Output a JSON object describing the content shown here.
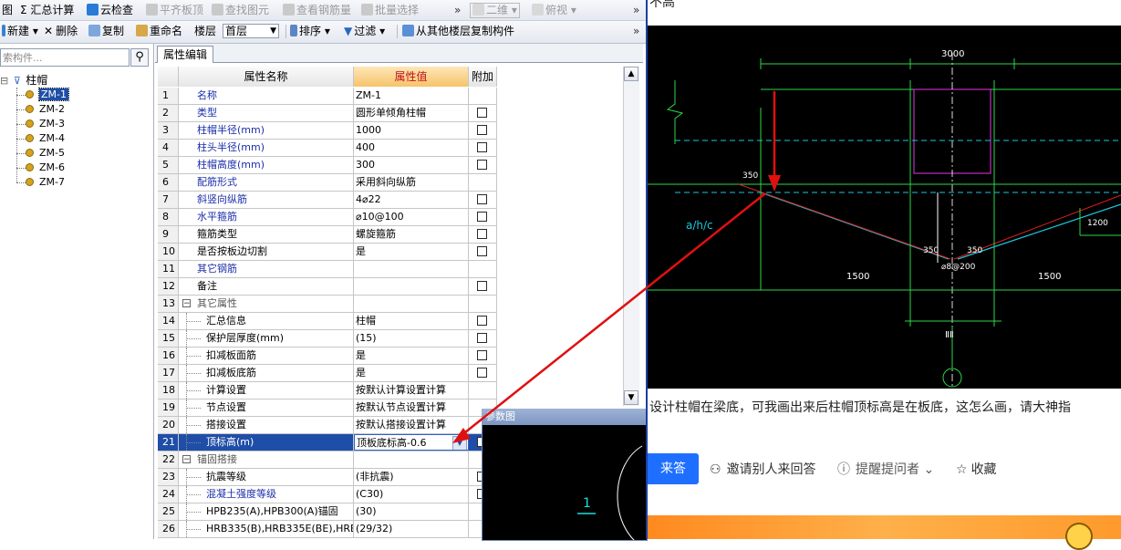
{
  "toolbar1": {
    "items": [
      "图",
      "Σ 汇总计算",
      "云检查",
      "平齐板顶",
      "查找图元",
      "查看钢筋量",
      "批量选择",
      "二维",
      "俯视"
    ],
    "overflow": "»"
  },
  "toolbar2": {
    "new_label": "新建",
    "delete_label": "删除",
    "copy_label": "复制",
    "rename_label": "重命名",
    "floor_label": "楼层",
    "floor_value": "首层",
    "sort_label": "排序",
    "filter_label": "过滤",
    "copy_from_floor_label": "从其他楼层复制构件",
    "overflow": "»"
  },
  "search": {
    "placeholder": "索构件..."
  },
  "tree": {
    "root": "柱帽",
    "items": [
      "ZM-1",
      "ZM-2",
      "ZM-3",
      "ZM-4",
      "ZM-5",
      "ZM-6",
      "ZM-7"
    ],
    "selected": "ZM-1"
  },
  "prop_tab": "属性编辑",
  "grid": {
    "headers": {
      "name": "属性名称",
      "value": "属性值",
      "extra": "附加"
    },
    "rows": [
      {
        "n": "1",
        "name": "名称",
        "value": "ZM-1",
        "style": "blue",
        "cb": false
      },
      {
        "n": "2",
        "name": "类型",
        "value": "圆形单倾角柱帽",
        "style": "blue",
        "cb": true
      },
      {
        "n": "3",
        "name": "柱帽半径(mm)",
        "value": "1000",
        "style": "blue",
        "cb": true
      },
      {
        "n": "4",
        "name": "柱头半径(mm)",
        "value": "400",
        "style": "blue",
        "cb": true
      },
      {
        "n": "5",
        "name": "柱帽高度(mm)",
        "value": "300",
        "style": "blue",
        "cb": true
      },
      {
        "n": "6",
        "name": "配筋形式",
        "value": "采用斜向纵筋",
        "style": "blue",
        "cb": false
      },
      {
        "n": "7",
        "name": "斜竖向纵筋",
        "value": "4⌀22",
        "style": "blue",
        "cb": true
      },
      {
        "n": "8",
        "name": "水平箍筋",
        "value": "⌀10@100",
        "style": "blue",
        "cb": true
      },
      {
        "n": "9",
        "name": "箍筋类型",
        "value": "螺旋箍筋",
        "style": "",
        "cb": true
      },
      {
        "n": "10",
        "name": "是否按板边切割",
        "value": "是",
        "style": "",
        "cb": true
      },
      {
        "n": "11",
        "name": "其它钢筋",
        "value": "",
        "style": "blue",
        "cb": false
      },
      {
        "n": "12",
        "name": "备注",
        "value": "",
        "style": "",
        "cb": true
      },
      {
        "n": "13",
        "name": "其它属性",
        "value": "",
        "style": "group",
        "cb": false
      },
      {
        "n": "14",
        "name": "汇总信息",
        "value": "柱帽",
        "style": "sub",
        "cb": true
      },
      {
        "n": "15",
        "name": "保护层厚度(mm)",
        "value": "(15)",
        "style": "sub",
        "cb": true
      },
      {
        "n": "16",
        "name": "扣减板面筋",
        "value": "是",
        "style": "sub",
        "cb": true
      },
      {
        "n": "17",
        "name": "扣减板底筋",
        "value": "是",
        "style": "sub",
        "cb": true
      },
      {
        "n": "18",
        "name": "计算设置",
        "value": "按默认计算设置计算",
        "style": "sub",
        "cb": false
      },
      {
        "n": "19",
        "name": "节点设置",
        "value": "按默认节点设置计算",
        "style": "sub",
        "cb": false
      },
      {
        "n": "20",
        "name": "搭接设置",
        "value": "按默认搭接设置计算",
        "style": "sub",
        "cb": false
      },
      {
        "n": "21",
        "name": "顶标高(m)",
        "value": "顶板底标高-0.6",
        "style": "selected",
        "cb": true
      },
      {
        "n": "22",
        "name": "锚固搭接",
        "value": "",
        "style": "group",
        "cb": false
      },
      {
        "n": "23",
        "name": "抗震等级",
        "value": "(非抗震)",
        "style": "sub",
        "cb": true
      },
      {
        "n": "24",
        "name": "混凝土强度等级",
        "value": "(C30)",
        "style": "subblue",
        "cb": true
      },
      {
        "n": "25",
        "name": "HPB235(A),HPB300(A)锚固",
        "value": "(30)",
        "style": "sub",
        "cb": false
      },
      {
        "n": "26",
        "name": "HRB335(B),HRB335E(BE),HRBF",
        "value": "(29/32)",
        "style": "sub",
        "cb": false
      }
    ]
  },
  "popup": {
    "title": "参数图",
    "label": "1"
  },
  "cad": {
    "dim_top": "3000",
    "dim_left": "1500",
    "dim_right": "1500",
    "label_350_a": "350",
    "label_350_b": "350",
    "label_350_c": "350",
    "label_rebar": "⌀8@200",
    "label_ah": "a/h/c",
    "label_1200": "1200",
    "label_bottom": "ⅡⅡ"
  },
  "question_text": "设计柱帽在梁底，可我画出来后柱帽顶标高是在板底，这怎么画，请大神指",
  "answer_button": "来答",
  "actions": {
    "invite": "邀请别人来回答",
    "remind": "提醒提问者",
    "collect": "收藏"
  },
  "top_fragment": "不高"
}
